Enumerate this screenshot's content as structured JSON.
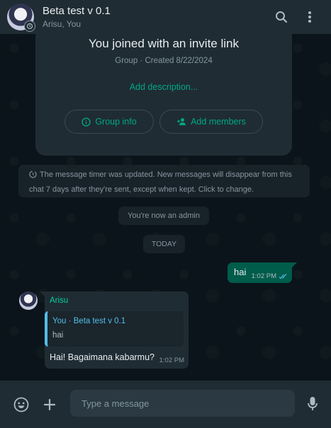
{
  "header": {
    "title": "Beta test v 0.1",
    "subtitle": "Arisu, You",
    "search_icon": "search-icon",
    "menu_icon": "more-vertical-icon"
  },
  "info_card": {
    "title": "You joined with an invite link",
    "meta": "Group · Created 8/22/2024",
    "add_description": "Add description...",
    "group_info_label": "Group info",
    "add_members_label": "Add members"
  },
  "system": {
    "timer_note": "The message timer was updated. New messages will disappear from this chat 7 days after they're sent, except when kept. Click to change.",
    "admin_note": "You're now an admin",
    "date_chip": "TODAY"
  },
  "messages": {
    "outgoing": {
      "text": "hai",
      "time": "1:02 PM"
    },
    "incoming": {
      "sender": "Arisu",
      "quote_header": "You · Beta test v 0.1",
      "quote_text": "hai",
      "text": "Hai! Bagaimana kabarmu?",
      "time": "1:02 PM"
    }
  },
  "composer": {
    "placeholder": "Type a message"
  },
  "colors": {
    "accent": "#00a884",
    "outgoing_bubble": "#005c4b",
    "incoming_bubble": "#1f2c34",
    "quote_bar": "#53bdeb",
    "sender_name": "#06cf9c"
  }
}
